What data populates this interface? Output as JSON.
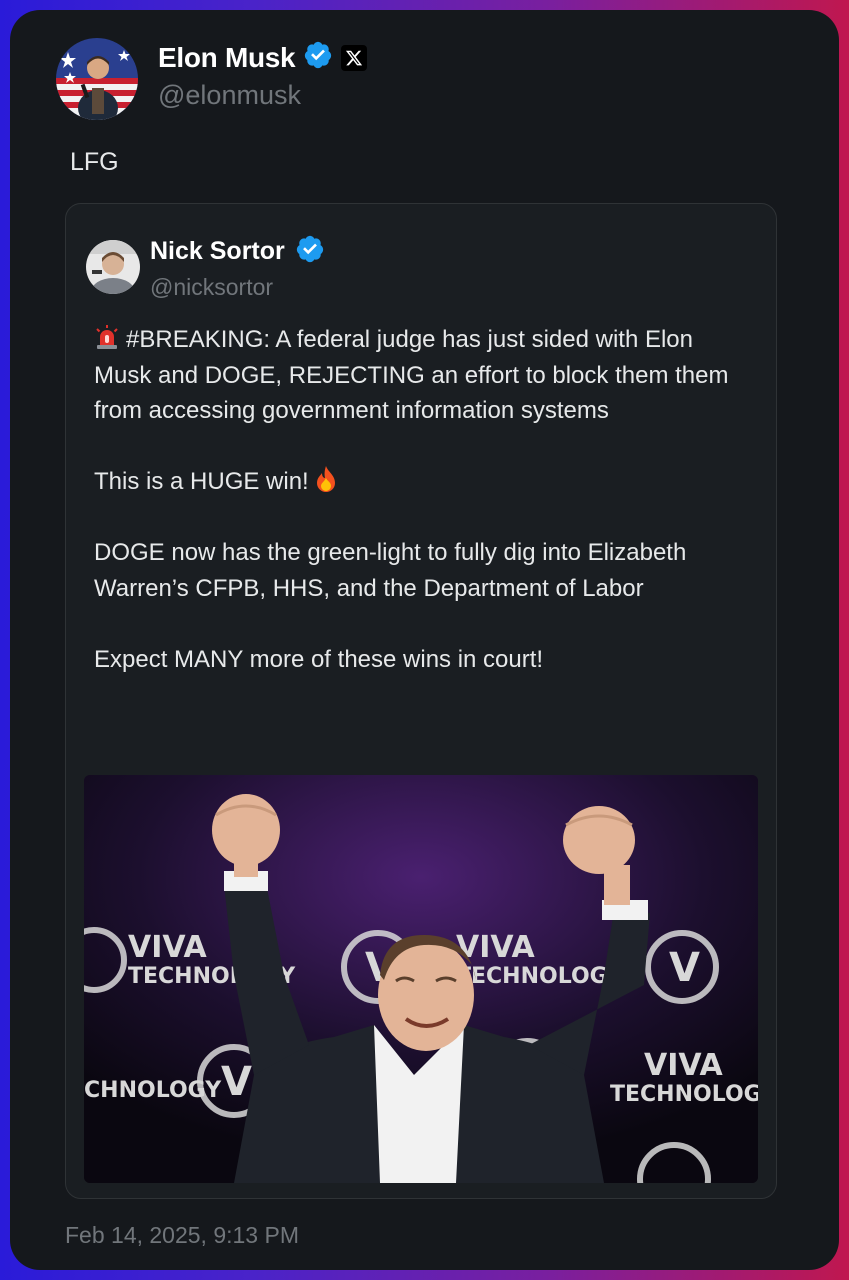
{
  "author": {
    "name": "Elon Musk",
    "handle": "@elonmusk",
    "verified": true,
    "badge_icon": "x-logo-icon"
  },
  "tweet": {
    "text": "LFG",
    "timestamp": "Feb 14, 2025, 9:13 PM"
  },
  "quoted": {
    "name": "Nick Sortor",
    "handle": "@nicksortor",
    "verified": true,
    "paragraphs": [
      "#BREAKING: A federal judge has just sided with Elon Musk and DOGE, REJECTING an effort to block them them from accessing government information systems",
      "This is a HUGE win!",
      "DOGE now has the green-light to fully dig into Elizabeth Warren’s CFPB, HHS, and the Department of Labor",
      "Expect MANY more of these wins in court!"
    ],
    "image": {
      "backdrop_lines": [
        "VIVA",
        "TECHNOLOGY"
      ],
      "logo_letter": "V"
    }
  },
  "colors": {
    "card_bg": "#15181c",
    "text": "#e7e9ea",
    "muted": "#71767b",
    "verified_blue": "#1d9bf0",
    "border": "#2f3336"
  }
}
